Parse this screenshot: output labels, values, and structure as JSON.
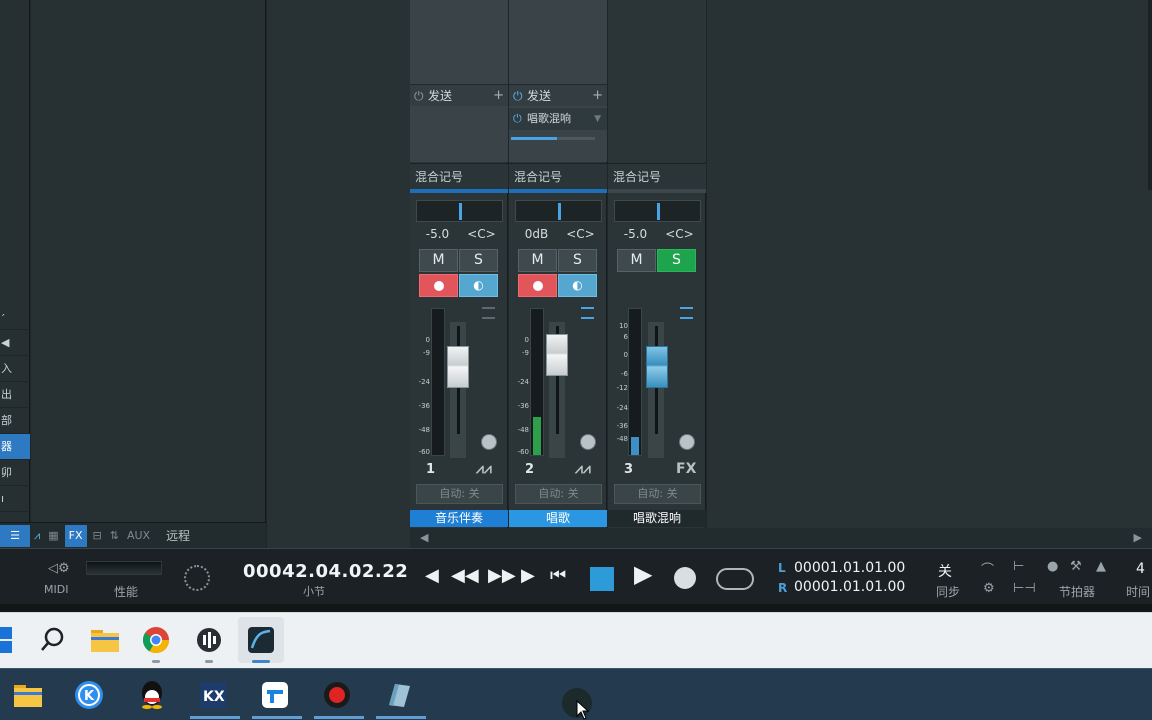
{
  "side_panel": {
    "labels": [
      "׳",
      "◀",
      "入",
      "出",
      "部",
      "器",
      "卯",
      "ı",
      "☰"
    ],
    "active_index": 5
  },
  "mixer_toolbar": {
    "items": [
      "⩘",
      "▦",
      "FX",
      "⊟",
      "⇅",
      "AUX"
    ],
    "remote": "远程"
  },
  "channels": [
    {
      "send_label": "发送",
      "send_add": "+",
      "name_top": "混合记号",
      "volume": "-5.0",
      "pan": "<C>",
      "mute": "M",
      "solo": "S",
      "number": "1",
      "type_icon": "⩘⩘",
      "automation": "自动: 关",
      "name": "音乐伴奏"
    },
    {
      "send_label": "发送",
      "send_add": "+",
      "insert_label": "唱歌混响",
      "name_top": "混合记号",
      "volume": "0dB",
      "pan": "<C>",
      "mute": "M",
      "solo": "S",
      "number": "2",
      "type_icon": "⩘⩘",
      "automation": "自动: 关",
      "name": "唱歌"
    },
    {
      "name_top": "混合记号",
      "volume": "-5.0",
      "pan": "<C>",
      "mute": "M",
      "solo": "S",
      "number": "3",
      "type_icon": "FX",
      "automation": "自动: 关",
      "name": "唱歌混响"
    }
  ],
  "meter_scale": [
    "0",
    "-9",
    "-24",
    "-36",
    "-48",
    "-60"
  ],
  "fx_scale": [
    "10",
    "6",
    "0",
    "-6",
    "-12",
    "-24",
    "-36",
    "-48"
  ],
  "transport": {
    "midi_label": "MIDI",
    "perf_label": "性能",
    "time": "00042.04.02.22",
    "time_unit": "小节",
    "l_label": "L",
    "r_label": "R",
    "l_value": "00001.01.01.00",
    "r_value": "00001.01.01.00",
    "sync_value": "关",
    "sync_label": "同步",
    "metronome_label": "节拍器",
    "signature": "4",
    "time_label": "时间"
  },
  "colors": {
    "accent_blue": "#2d79c2",
    "solo_green": "#1ea44c",
    "record_red": "#e2555a",
    "monitor_blue": "#56a7d0"
  },
  "taskbar_top": [
    "windows-icon",
    "search-icon",
    "folder-icon",
    "chrome-icon",
    "sound-icon",
    "studio-one-icon"
  ],
  "taskbar_bottom": [
    "file-explorer-icon",
    "kugou-icon",
    "qq-icon",
    "kx-icon",
    "tencent-app-icon",
    "recorder-icon",
    "notes-icon"
  ]
}
